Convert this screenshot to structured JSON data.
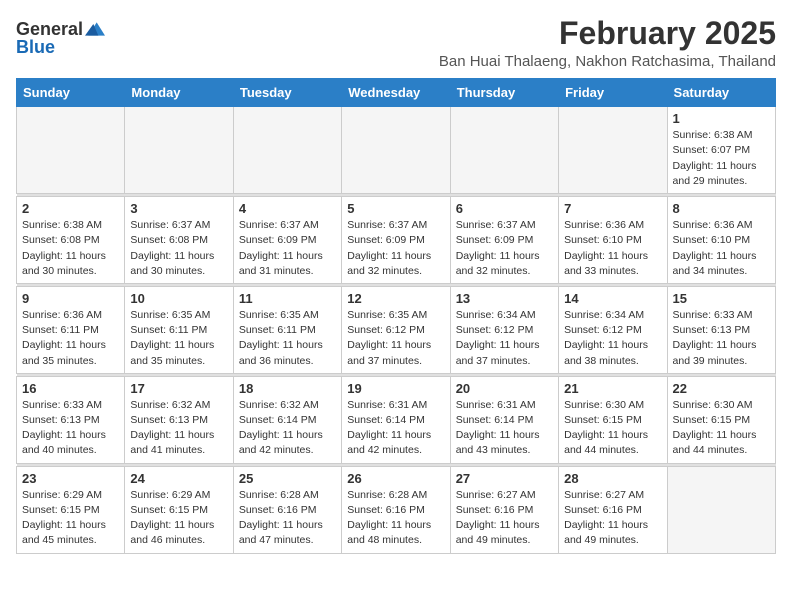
{
  "logo": {
    "general": "General",
    "blue": "Blue"
  },
  "title": {
    "month_year": "February 2025",
    "location": "Ban Huai Thalaeng, Nakhon Ratchasima, Thailand"
  },
  "weekdays": [
    "Sunday",
    "Monday",
    "Tuesday",
    "Wednesday",
    "Thursday",
    "Friday",
    "Saturday"
  ],
  "weeks": [
    [
      {
        "day": "",
        "info": ""
      },
      {
        "day": "",
        "info": ""
      },
      {
        "day": "",
        "info": ""
      },
      {
        "day": "",
        "info": ""
      },
      {
        "day": "",
        "info": ""
      },
      {
        "day": "",
        "info": ""
      },
      {
        "day": "1",
        "info": "Sunrise: 6:38 AM\nSunset: 6:07 PM\nDaylight: 11 hours and 29 minutes."
      }
    ],
    [
      {
        "day": "2",
        "info": "Sunrise: 6:38 AM\nSunset: 6:08 PM\nDaylight: 11 hours and 30 minutes."
      },
      {
        "day": "3",
        "info": "Sunrise: 6:37 AM\nSunset: 6:08 PM\nDaylight: 11 hours and 30 minutes."
      },
      {
        "day": "4",
        "info": "Sunrise: 6:37 AM\nSunset: 6:09 PM\nDaylight: 11 hours and 31 minutes."
      },
      {
        "day": "5",
        "info": "Sunrise: 6:37 AM\nSunset: 6:09 PM\nDaylight: 11 hours and 32 minutes."
      },
      {
        "day": "6",
        "info": "Sunrise: 6:37 AM\nSunset: 6:09 PM\nDaylight: 11 hours and 32 minutes."
      },
      {
        "day": "7",
        "info": "Sunrise: 6:36 AM\nSunset: 6:10 PM\nDaylight: 11 hours and 33 minutes."
      },
      {
        "day": "8",
        "info": "Sunrise: 6:36 AM\nSunset: 6:10 PM\nDaylight: 11 hours and 34 minutes."
      }
    ],
    [
      {
        "day": "9",
        "info": "Sunrise: 6:36 AM\nSunset: 6:11 PM\nDaylight: 11 hours and 35 minutes."
      },
      {
        "day": "10",
        "info": "Sunrise: 6:35 AM\nSunset: 6:11 PM\nDaylight: 11 hours and 35 minutes."
      },
      {
        "day": "11",
        "info": "Sunrise: 6:35 AM\nSunset: 6:11 PM\nDaylight: 11 hours and 36 minutes."
      },
      {
        "day": "12",
        "info": "Sunrise: 6:35 AM\nSunset: 6:12 PM\nDaylight: 11 hours and 37 minutes."
      },
      {
        "day": "13",
        "info": "Sunrise: 6:34 AM\nSunset: 6:12 PM\nDaylight: 11 hours and 37 minutes."
      },
      {
        "day": "14",
        "info": "Sunrise: 6:34 AM\nSunset: 6:12 PM\nDaylight: 11 hours and 38 minutes."
      },
      {
        "day": "15",
        "info": "Sunrise: 6:33 AM\nSunset: 6:13 PM\nDaylight: 11 hours and 39 minutes."
      }
    ],
    [
      {
        "day": "16",
        "info": "Sunrise: 6:33 AM\nSunset: 6:13 PM\nDaylight: 11 hours and 40 minutes."
      },
      {
        "day": "17",
        "info": "Sunrise: 6:32 AM\nSunset: 6:13 PM\nDaylight: 11 hours and 41 minutes."
      },
      {
        "day": "18",
        "info": "Sunrise: 6:32 AM\nSunset: 6:14 PM\nDaylight: 11 hours and 42 minutes."
      },
      {
        "day": "19",
        "info": "Sunrise: 6:31 AM\nSunset: 6:14 PM\nDaylight: 11 hours and 42 minutes."
      },
      {
        "day": "20",
        "info": "Sunrise: 6:31 AM\nSunset: 6:14 PM\nDaylight: 11 hours and 43 minutes."
      },
      {
        "day": "21",
        "info": "Sunrise: 6:30 AM\nSunset: 6:15 PM\nDaylight: 11 hours and 44 minutes."
      },
      {
        "day": "22",
        "info": "Sunrise: 6:30 AM\nSunset: 6:15 PM\nDaylight: 11 hours and 44 minutes."
      }
    ],
    [
      {
        "day": "23",
        "info": "Sunrise: 6:29 AM\nSunset: 6:15 PM\nDaylight: 11 hours and 45 minutes."
      },
      {
        "day": "24",
        "info": "Sunrise: 6:29 AM\nSunset: 6:15 PM\nDaylight: 11 hours and 46 minutes."
      },
      {
        "day": "25",
        "info": "Sunrise: 6:28 AM\nSunset: 6:16 PM\nDaylight: 11 hours and 47 minutes."
      },
      {
        "day": "26",
        "info": "Sunrise: 6:28 AM\nSunset: 6:16 PM\nDaylight: 11 hours and 48 minutes."
      },
      {
        "day": "27",
        "info": "Sunrise: 6:27 AM\nSunset: 6:16 PM\nDaylight: 11 hours and 49 minutes."
      },
      {
        "day": "28",
        "info": "Sunrise: 6:27 AM\nSunset: 6:16 PM\nDaylight: 11 hours and 49 minutes."
      },
      {
        "day": "",
        "info": ""
      }
    ]
  ]
}
